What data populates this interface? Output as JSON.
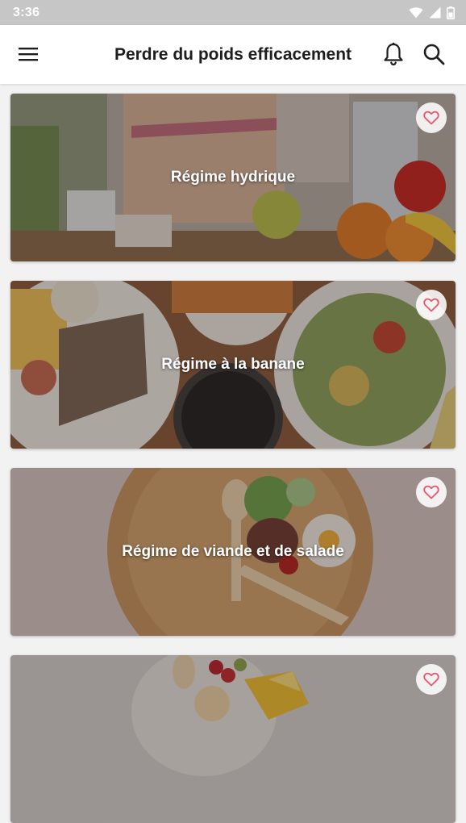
{
  "status_bar": {
    "time": "3:36",
    "icons": [
      "wifi-icon",
      "cellular-icon",
      "battery-icon"
    ]
  },
  "app_bar": {
    "title": "Perdre du poids efficacement",
    "menu_icon": "hamburger-menu-icon",
    "notification_icon": "bell-icon",
    "search_icon": "search-icon"
  },
  "diets": [
    {
      "title": "Régime hydrique",
      "image": "waist-measure-water-fruits-photo",
      "favorite": false
    },
    {
      "title": "Régime à la banane",
      "image": "fish-fries-salad-alarm-clock-photo",
      "favorite": false
    },
    {
      "title": "Régime de viande et de salade",
      "image": "wooden-plate-meat-egg-salad-photo",
      "favorite": false
    },
    {
      "title": "",
      "image": "eggs-vegetables-photo",
      "favorite": false
    }
  ],
  "colors": {
    "status_bar": "#c6c6c6",
    "app_bar": "#ffffff",
    "background": "#f2f2f2",
    "heart": "#e5566f"
  }
}
